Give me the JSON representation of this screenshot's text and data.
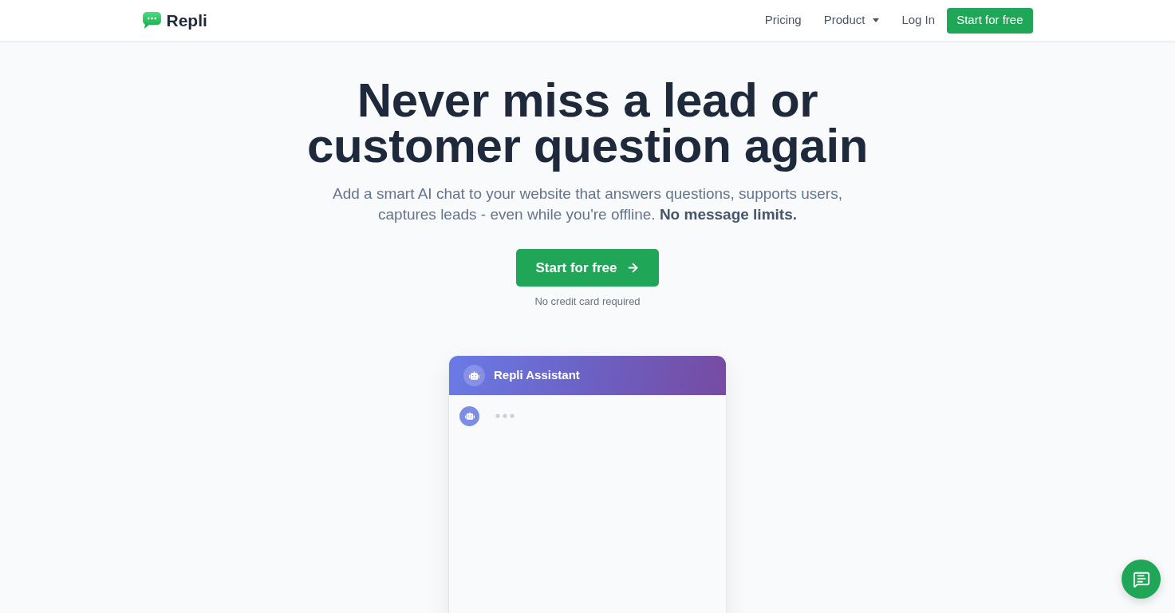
{
  "header": {
    "logo": "Repli",
    "nav": [
      {
        "label": "Pricing",
        "kind": "link"
      },
      {
        "label": "Product",
        "kind": "dropdown"
      },
      {
        "label": "Log In",
        "kind": "link"
      }
    ],
    "cta": "Start for free"
  },
  "hero": {
    "title_lines": [
      "Never miss a lead or",
      "customer question again"
    ],
    "subtitle": "Add a smart AI chat to your website that answers questions, supports users, captures leads - even while you're offline. **No message limits.**",
    "cta": "Start for free",
    "note": "No credit card required"
  },
  "chat_preview": {
    "title": "Repli Assistant",
    "messages": [
      {
        "kind": "typing"
      }
    ]
  }
}
